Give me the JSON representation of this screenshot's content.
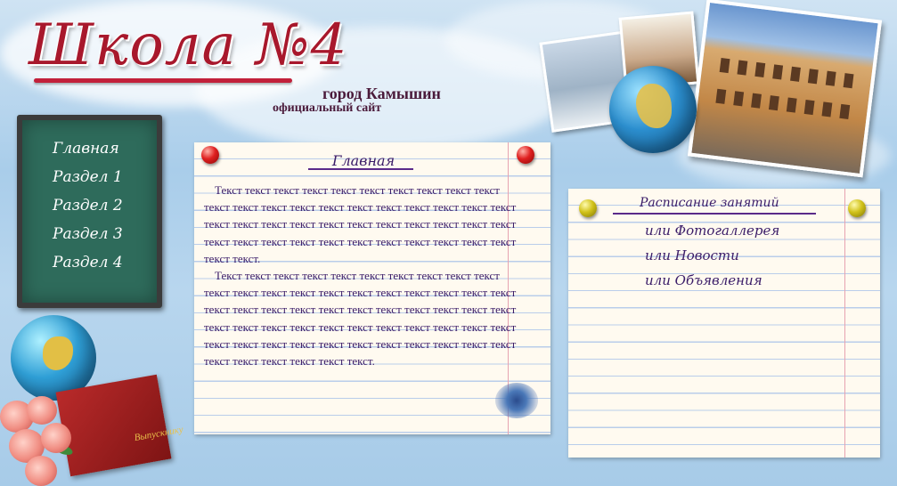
{
  "header": {
    "site_title": "Школа №4",
    "city": "город  Камышин",
    "tagline": "официальный  сайт"
  },
  "menu": {
    "items": [
      "Главная",
      "Раздел 1",
      "Раздел 2",
      "Раздел 3",
      "Раздел 4"
    ]
  },
  "main": {
    "heading": "Главная",
    "paragraph1": "Текст текст текст текст текст текст текст текст текст текст текст текст текст текст текст текст текст текст текст текст текст текст текст текст текст текст текст текст текст текст текст текст текст текст текст текст текст текст текст текст текст текст текст текст текст.",
    "paragraph2": "Текст текст текст текст текст текст текст текст текст текст текст текст текст текст текст текст текст текст текст текст текст текст текст текст текст текст текст текст текст текст текст текст текст текст текст текст текст текст текст текст текст текст текст текст текст текст текст текст текст текст текст текст текст текст текст текст текст текст текст текст."
  },
  "sidebar_panel": {
    "heading": "Расписание занятий",
    "links": [
      "или Фотогаллерея",
      "или Новости",
      "или Объявления"
    ]
  },
  "decoration": {
    "book_label": "Выпускнику"
  },
  "colors": {
    "title_red": "#a8182c",
    "text_purple": "#3a1c68",
    "chalkboard_green": "#2e6b5b"
  }
}
